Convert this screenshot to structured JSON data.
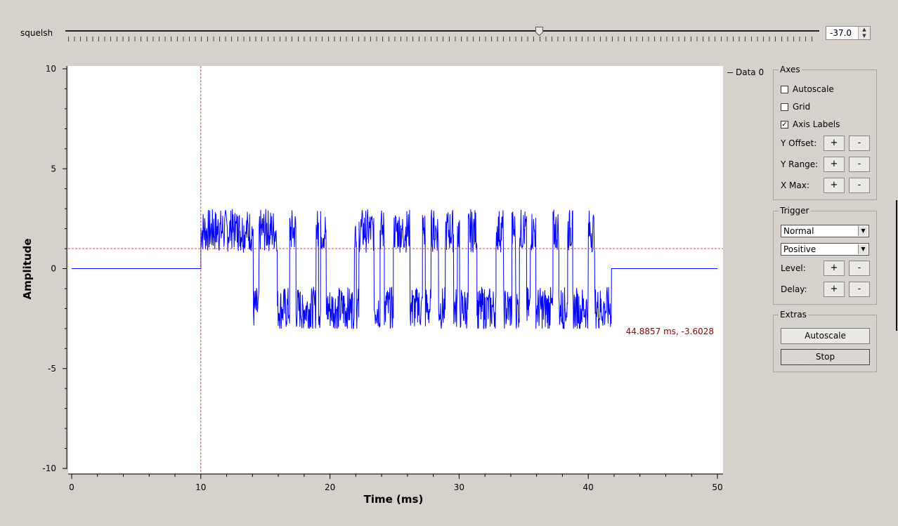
{
  "squelch": {
    "label": "squelsh",
    "value": "-37.0",
    "slider_fraction": 0.628
  },
  "chart_data": {
    "type": "line",
    "xlabel": "Time (ms)",
    "ylabel": "Amplitude",
    "xlim": [
      0,
      50
    ],
    "ylim": [
      -10,
      10
    ],
    "x_ticks": [
      "0",
      "10",
      "20",
      "30",
      "40",
      "50"
    ],
    "y_ticks": [
      "10",
      "5",
      "0",
      "-5",
      "-10"
    ],
    "grid": false,
    "legend": "top-right",
    "series": [
      {
        "name": "Data 0",
        "color": "#0000ff",
        "description_note": "",
        "segments": [
          {
            "x_start": 0,
            "x_end": 10,
            "level": 0
          },
          {
            "x_start": 10,
            "x_end": 41.8,
            "high": 3.1,
            "low": -3.0
          },
          {
            "x_start": 41.8,
            "x_end": 50,
            "level": 0
          }
        ]
      }
    ],
    "trigger_markers": {
      "time_ms": 10,
      "level": 1.0,
      "color": "#e04040"
    },
    "cursor_readout": "44.8857 ms, -3.6028",
    "cursor_color": "#8b0000"
  },
  "legend": {
    "label": "Data 0"
  },
  "axes_panel": {
    "title": "Axes",
    "autoscale": {
      "label": "Autoscale",
      "checked": false
    },
    "grid": {
      "label": "Grid",
      "checked": false
    },
    "axis_labels": {
      "label": "Axis Labels",
      "checked": true,
      "mark": "✓"
    },
    "y_offset": "Y Offset:",
    "y_range": "Y Range:",
    "x_max": "X Max:",
    "plus": "+",
    "minus": "-"
  },
  "trigger_panel": {
    "title": "Trigger",
    "mode": "Normal",
    "slope": "Positive",
    "level": "Level:",
    "delay": "Delay:",
    "plus": "+",
    "minus": "-"
  },
  "extras_panel": {
    "title": "Extras",
    "autoscale": "Autoscale",
    "stop": "Stop"
  }
}
